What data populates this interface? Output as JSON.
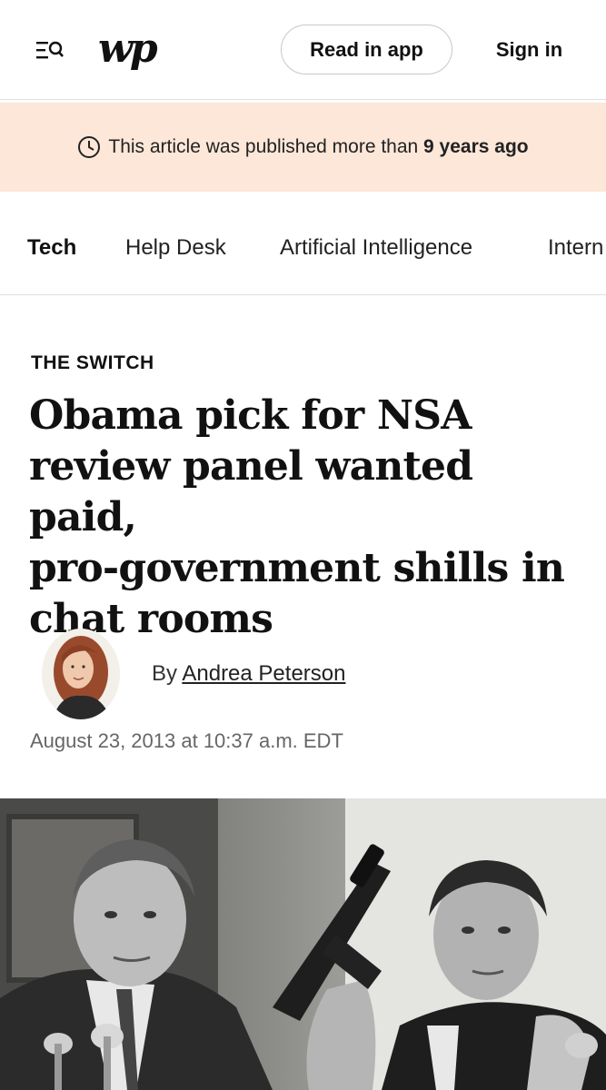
{
  "header": {
    "menu_icon": "menu-search-icon",
    "logo_text": "wp",
    "read_in_app_label": "Read in app",
    "sign_in_label": "Sign in"
  },
  "notice": {
    "icon": "clock-icon",
    "prefix": "This article was published more than ",
    "emphasis": "9 years ago"
  },
  "nav": {
    "items": [
      {
        "label": "Tech",
        "active": true
      },
      {
        "label": "Help Desk"
      },
      {
        "label": "Artificial Intelligence"
      },
      {
        "label": "Intern"
      }
    ]
  },
  "article": {
    "kicker": "THE SWITCH",
    "headline_lines": [
      "Obama pick for NSA",
      "review panel wanted paid,",
      "pro-government shills in",
      "chat rooms"
    ],
    "byline_prefix": "By ",
    "author": "Andrea Peterson",
    "date": "August 23, 2013 at 10:37 a.m. EDT"
  },
  "colors": {
    "notice_bg": "#fde7d9",
    "text": "#111111",
    "muted": "#666666"
  }
}
